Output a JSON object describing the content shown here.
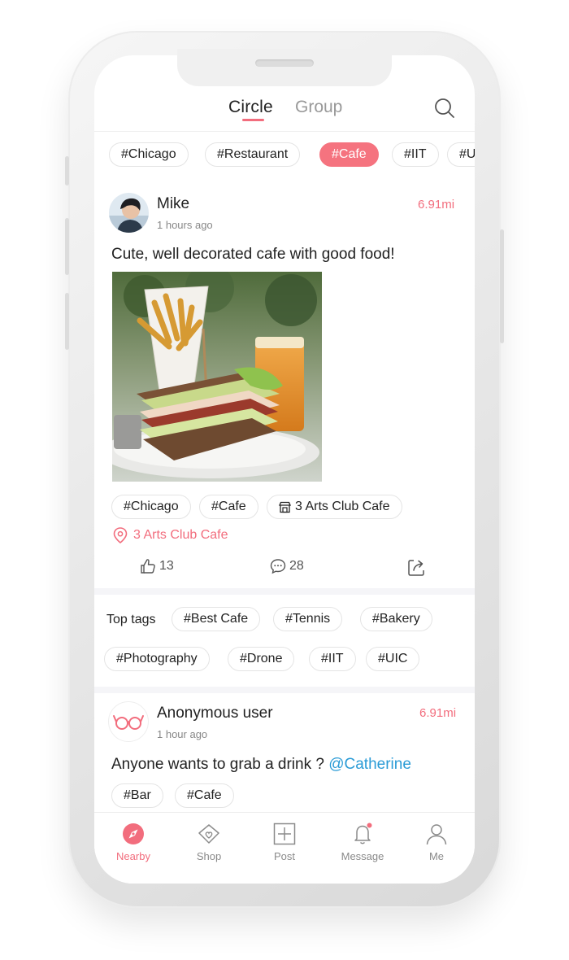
{
  "header": {
    "tabs": [
      {
        "label": "Circle",
        "active": true
      },
      {
        "label": "Group",
        "active": false
      }
    ]
  },
  "filter_tags": [
    {
      "label": "#Chicago",
      "active": false
    },
    {
      "label": "#Restaurant",
      "active": false
    },
    {
      "label": "#Cafe",
      "active": true
    },
    {
      "label": "#IIT",
      "active": false
    },
    {
      "label": "#U",
      "active": false
    }
  ],
  "posts": [
    {
      "user": "Mike",
      "time": "1 hours ago",
      "distance": "6.91mi",
      "text": "Cute, well decorated cafe with good food!",
      "tags": [
        "#Chicago",
        "#Cafe"
      ],
      "place_tag": "3 Arts Club Cafe",
      "location": "3 Arts Club Cafe",
      "likes": "13",
      "comments": "28"
    },
    {
      "user": "Anonymous user",
      "time": "1 hour ago",
      "distance": "6.91mi",
      "text": "Anyone wants to grab a drink ? ",
      "mention": "@Catherine",
      "tags": [
        "#Bar",
        "#Cafe"
      ]
    }
  ],
  "top_tags": {
    "label": "Top tags",
    "row1": [
      "#Best Cafe",
      "#Tennis",
      "#Bakery"
    ],
    "row2": [
      "#Photography",
      "#Drone",
      "#IIT",
      "#UIC"
    ]
  },
  "nav": [
    {
      "label": "Nearby",
      "icon": "compass-icon",
      "active": true
    },
    {
      "label": "Shop",
      "icon": "shopping-bag-heart-icon",
      "active": false
    },
    {
      "label": "Post",
      "icon": "plus-square-icon",
      "active": false
    },
    {
      "label": "Message",
      "icon": "bell-icon",
      "active": false,
      "badge": true
    },
    {
      "label": "Me",
      "icon": "user-icon",
      "active": false
    }
  ],
  "colors": {
    "accent": "#f26d7d",
    "mention": "#2a9bd6",
    "text": "#222222",
    "muted": "#888888"
  }
}
